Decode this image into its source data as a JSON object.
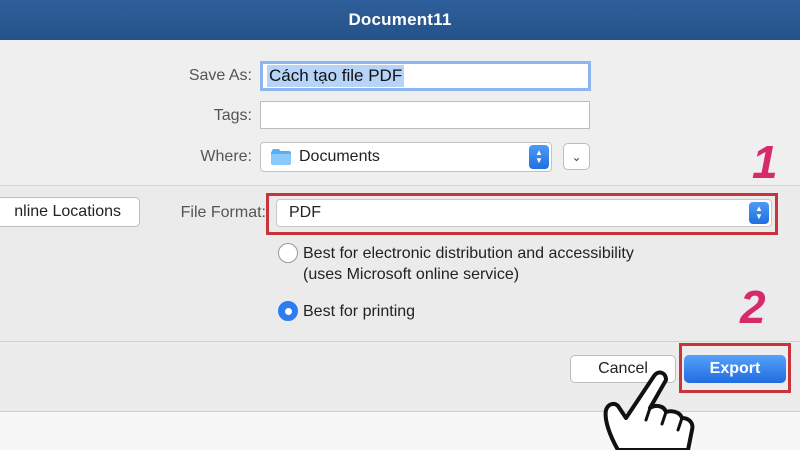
{
  "window": {
    "title": "Document11"
  },
  "form": {
    "save_as_label": "Save As:",
    "save_as_value": "Cách tạo file PDF",
    "tags_label": "Tags:",
    "tags_value": "",
    "where_label": "Where:",
    "where_value": "Documents"
  },
  "online_locations_label": "nline Locations",
  "file_format": {
    "label": "File Format:",
    "value": "PDF",
    "options": [
      {
        "line1": "Best for electronic distribution and accessibility",
        "line2": "(uses Microsoft online service)",
        "selected": false
      },
      {
        "line1": "Best for printing",
        "selected": true
      }
    ]
  },
  "buttons": {
    "cancel": "Cancel",
    "export": "Export"
  },
  "annotations": {
    "step1": "1",
    "step2": "2",
    "highlight_color": "#c7343a",
    "number_color": "#d72a6a"
  },
  "colors": {
    "titlebar": "#2a5a95",
    "accent": "#2d7cf0"
  }
}
